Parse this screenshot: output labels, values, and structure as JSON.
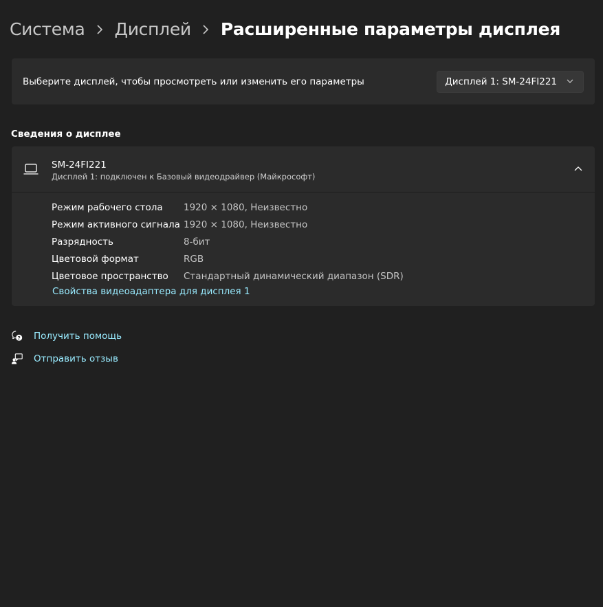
{
  "breadcrumb": {
    "items": [
      "Система",
      "Дисплей"
    ],
    "current": "Расширенные параметры дисплея"
  },
  "display_select": {
    "label": "Выберите дисплей, чтобы просмотреть или изменить его параметры",
    "selected": "Дисплей 1: SM-24FI221"
  },
  "section": {
    "title": "Сведения о дисплее"
  },
  "display_info": {
    "name": "SM-24FI221",
    "subtitle": "Дисплей 1: подключен к Базовый видеодрайвер (Майкрософт)",
    "rows": [
      {
        "key": "Режим рабочего стола",
        "value": "1920 × 1080, Неизвестно"
      },
      {
        "key": "Режим активного сигнала",
        "value": "1920 × 1080, Неизвестно"
      },
      {
        "key": "Разрядность",
        "value": "8-бит"
      },
      {
        "key": "Цветовой формат",
        "value": "RGB"
      },
      {
        "key": "Цветовое пространство",
        "value": "Стандартный динамический диапазон (SDR)"
      }
    ],
    "adapter_link": "Свойства видеоадаптера для дисплея 1"
  },
  "links": {
    "help": "Получить помощь",
    "feedback": "Отправить отзыв"
  },
  "icons": {
    "monitor": "monitor-icon",
    "chevron_up": "chevron-up-icon",
    "chevron_down": "chevron-down-icon",
    "breadcrumb_separator": "chevron-right-icon",
    "help": "help-icon",
    "feedback": "feedback-icon"
  },
  "colors": {
    "background": "#202020",
    "card": "#2b2b2b",
    "link": "#99ebff",
    "secondary_text": "#c5c5c5"
  }
}
